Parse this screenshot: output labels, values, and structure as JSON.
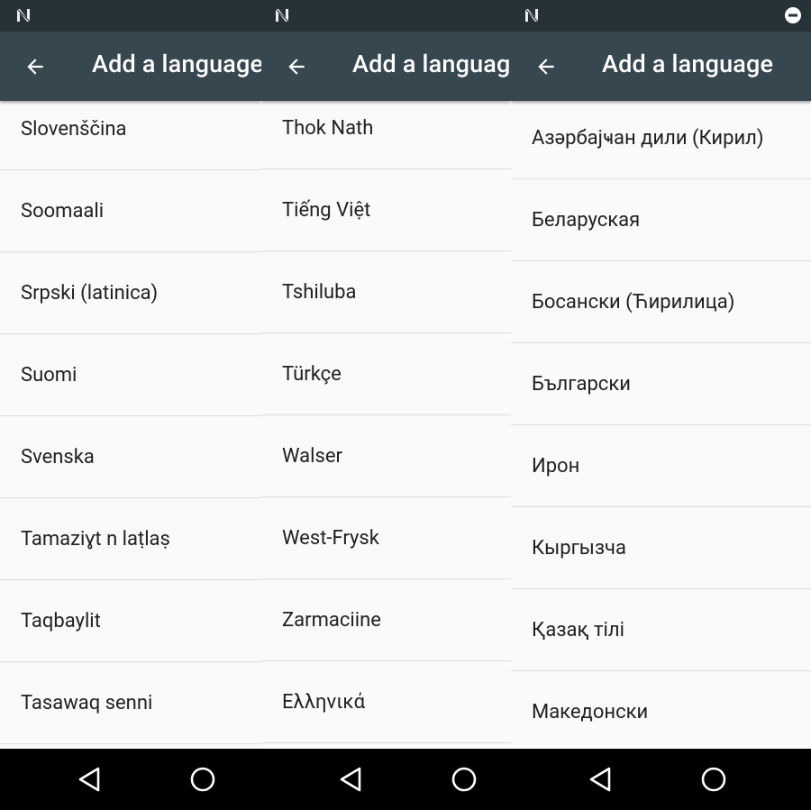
{
  "panels": [
    {
      "title": "Add a language",
      "items": [
        "Slovenščina",
        "Soomaali",
        "Srpski (latinica)",
        "Suomi",
        "Svenska",
        "Tamaziɣt n laṭlaṣ",
        "Taqbaylit",
        "Tasawaq senni"
      ]
    },
    {
      "title": "Add a language",
      "items": [
        "Thok Nath",
        "Tiếng Việt",
        "Tshiluba",
        "Türkçe",
        "Walser",
        "West-Frysk",
        "Zarmaciine",
        "Ελληνικά"
      ]
    },
    {
      "title": "Add a language",
      "items": [
        "Азәрбајҹан дили (Кирил)",
        "Беларуская",
        "Босански (Ћирилица)",
        "Български",
        "Ирон",
        "Кыргызча",
        "Қазақ тілі",
        "Македонски"
      ]
    }
  ],
  "colors": {
    "statusbar": "#263238",
    "appbar": "#37474f",
    "background": "#fafafa",
    "text": "#212121"
  },
  "icons": {
    "status": "notification-n-icon",
    "dnd": "do-not-disturb-icon",
    "back": "arrow-back-icon",
    "nav_back": "nav-back-triangle-icon",
    "nav_home": "nav-home-circle-icon"
  }
}
